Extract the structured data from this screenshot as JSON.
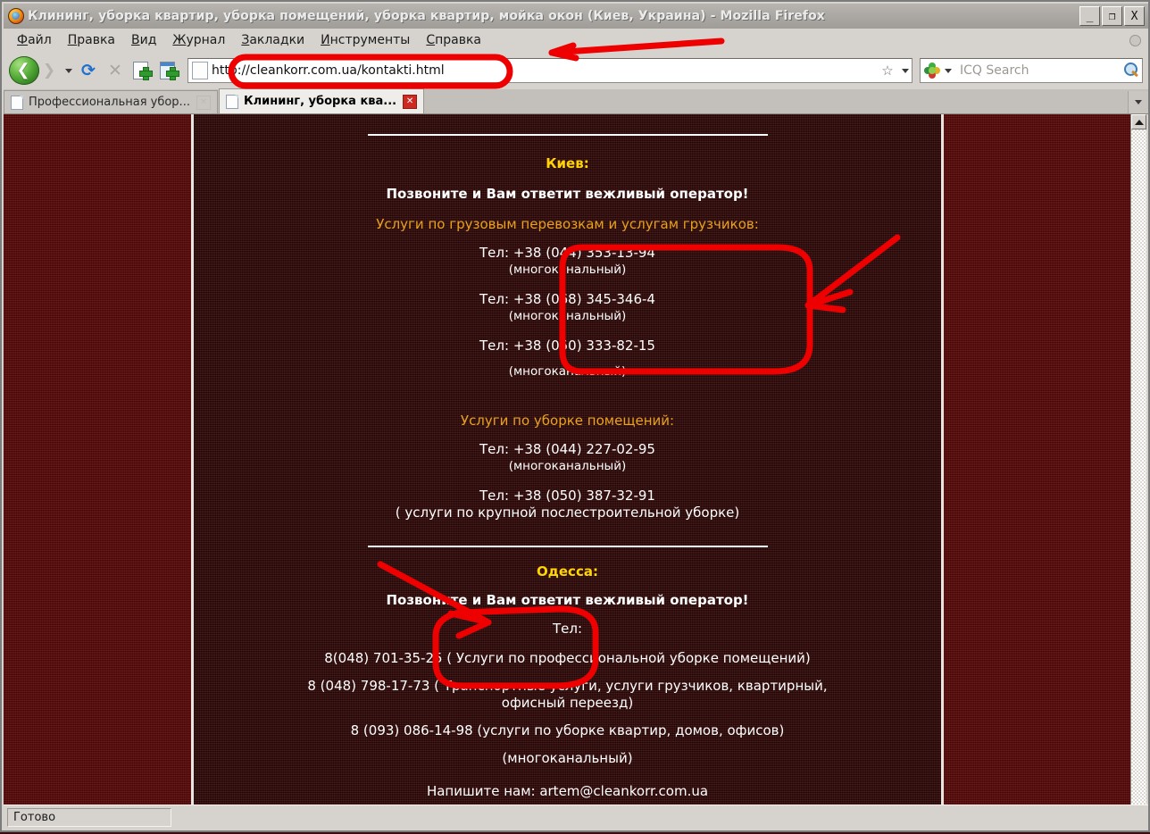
{
  "window": {
    "title": "Клининг, уборка квартир, уборка помещений, уборка квартир, мойка окон (Киев, Украина) - Mozilla Firefox",
    "minimize_label": "_",
    "restore_label": "❐",
    "close_label": "X"
  },
  "menu": {
    "items": [
      {
        "pre": "",
        "acc": "Ф",
        "post": "айл"
      },
      {
        "pre": "",
        "acc": "П",
        "post": "равка"
      },
      {
        "pre": "",
        "acc": "В",
        "post": "ид"
      },
      {
        "pre": "",
        "acc": "Ж",
        "post": "урнал"
      },
      {
        "pre": "",
        "acc": "З",
        "post": "акладки"
      },
      {
        "pre": "",
        "acc": "И",
        "post": "нструменты"
      },
      {
        "pre": "",
        "acc": "С",
        "post": "правка"
      }
    ]
  },
  "toolbar": {
    "back_glyph": "❮",
    "forward_glyph": "❯",
    "reload_glyph": "⟳",
    "stop_glyph": "✕",
    "star_glyph": "☆",
    "url": "http://cleankorr.com.ua/kontakti.html",
    "search_placeholder": "ICQ Search"
  },
  "tabs": [
    {
      "label": "Профессиональная убор...",
      "active": false,
      "close_glyph": "✕"
    },
    {
      "label": "Клининг, уборка ква...",
      "active": true,
      "close_glyph": "✕"
    }
  ],
  "page": {
    "sections": [
      {
        "city": "Киев:",
        "call_line": "Позвоните и Вам ответит вежливый оператор!",
        "groups": [
          {
            "heading": "Услуги по грузовым перевозкам и услугам грузчиков:",
            "entries": [
              {
                "phone": "Тел: +38 (044) 353-13-94",
                "note": "(многоканальный)"
              },
              {
                "phone": "Тел: +38 (068) 345-346-4",
                "note": "(многоканальный)"
              },
              {
                "phone": "Тел: +38 (050) 333-82-15",
                "note": "(многоканальный)"
              }
            ]
          },
          {
            "heading": "Услуги по уборке помещений:",
            "entries": [
              {
                "phone": "Тел: +38 (044) 227-02-95",
                "note": "(многоканальный)"
              },
              {
                "phone": "Тел: +38 (050) 387-32-91",
                "note": "( услуги по крупной послестроительной уборке)"
              }
            ]
          }
        ]
      },
      {
        "city": "Одесса:",
        "call_line": "Позвоните и Вам ответит вежливый оператор!",
        "tel_label": "Тел:",
        "lines": [
          "8(048) 701-35-25 ( Услуги по профессиональной уборке помещений)",
          "8 (048) 798-17-73 ( Транспортные услуги, услуги грузчиков, квартирный,",
          "офисный переезд)",
          "8 (093) 086-14-98 (услуги по уборке квартир, домов, офисов)",
          "(многоканальный)"
        ],
        "email_line": "Напишите нам:  artem@cleankorr.com.ua"
      }
    ]
  },
  "statusbar": {
    "text": "Готово"
  },
  "colors": {
    "page_background": "#6e1010",
    "content_column": "#3b1414",
    "city_heading": "#ffd400",
    "section_heading": "#e8a21c",
    "body_text": "#ffffff",
    "annotation": "#ee0000",
    "chrome": "#d6d3ce"
  }
}
